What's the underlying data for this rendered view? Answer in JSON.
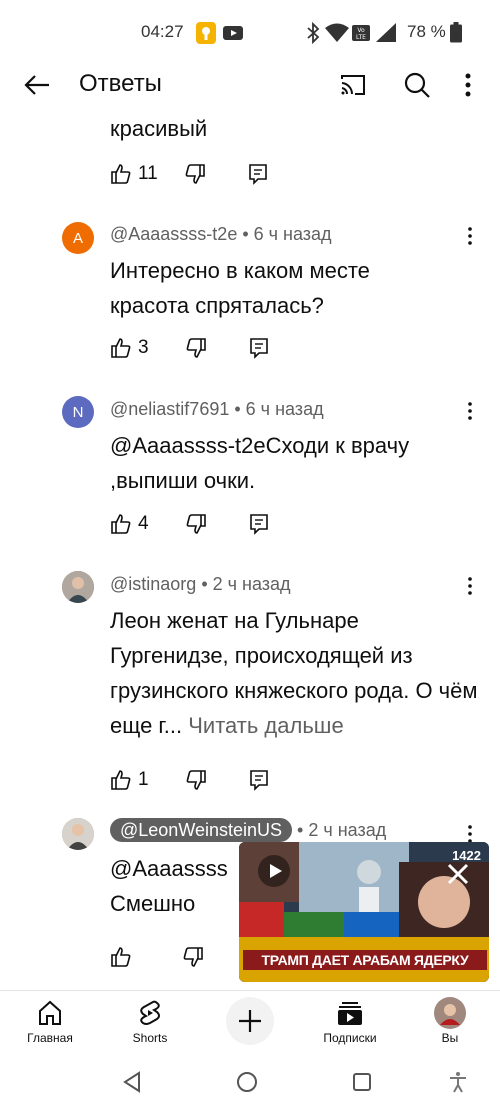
{
  "status_bar": {
    "time": "04:27",
    "battery_percent": "78 %",
    "icons": [
      "notification-icon",
      "youtube-icon",
      "bluetooth-icon",
      "wifi-icon",
      "volte-icon",
      "signal-icon",
      "battery-icon"
    ]
  },
  "header": {
    "title": "Ответы",
    "icons": [
      "back-arrow-icon",
      "cast-icon",
      "search-icon",
      "more-vert-icon"
    ]
  },
  "previous_comment": {
    "text_tail": "красивый",
    "likes": "11"
  },
  "comments": [
    {
      "author": "@Aaaassss-t2e",
      "time": "6 ч назад",
      "avatar_letter": "A",
      "avatar_color": "#ef6c00",
      "text": "Интересно в каком месте красота спряталась?",
      "likes": "3"
    },
    {
      "author": "@neliastif7691",
      "time": "6 ч назад",
      "avatar_letter": "N",
      "avatar_color": "#5c6bc0",
      "text": "@Aaaassss-t2eСходи к врачу ,выпиши очки.",
      "likes": "4"
    },
    {
      "author": "@istinaorg",
      "time": "2 ч назад",
      "avatar_letter": "",
      "avatar_color": "#8d6e63",
      "text": "Леон женат на Гульнаре Гургенидзе, происходящей из грузинского княжеского рода. О чём еще г...",
      "read_more": "Читать дальше",
      "likes": "1"
    },
    {
      "author": "@LeonWeinsteinUS",
      "time": "2 ч назад",
      "avatar_letter": "",
      "avatar_color": "#9e9e9e",
      "text_line1": "@Aaaassss",
      "text_line2": "Смешно",
      "likes": ""
    }
  ],
  "mini_player": {
    "caption": "ТРАМП ДАЕТ АРАБАМ ЯДЕРКУ",
    "counter": "1422"
  },
  "bottom_nav": {
    "items": [
      {
        "label": "Главная",
        "icon": "home-icon"
      },
      {
        "label": "Shorts",
        "icon": "shorts-icon"
      },
      {
        "label": "",
        "icon": "create-plus-icon"
      },
      {
        "label": "Подписки",
        "icon": "subscriptions-icon"
      },
      {
        "label": "Вы",
        "icon": "profile-avatar"
      }
    ]
  },
  "colors": {
    "text_primary": "#0f0f0f",
    "text_secondary": "#606060",
    "accent_red": "#ff0000"
  }
}
